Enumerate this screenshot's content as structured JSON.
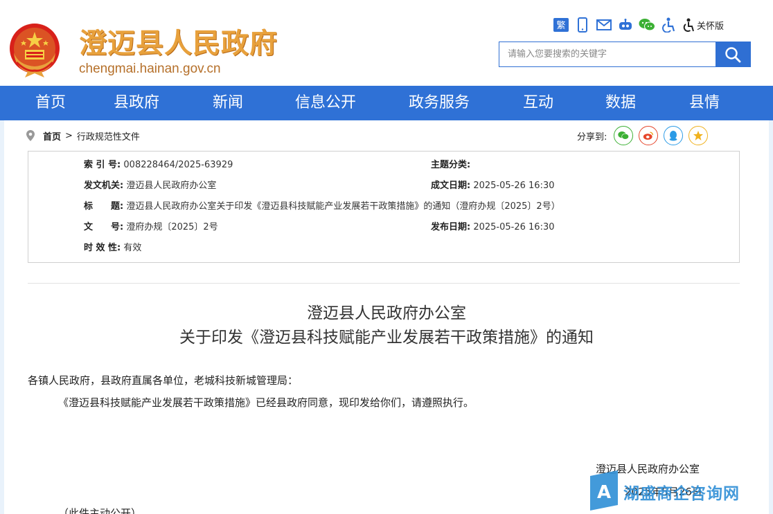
{
  "header": {
    "site_title": "澄迈县人民政府",
    "site_domain": "chengmai.hainan.gov.cn",
    "care_mode_label": "关怀版",
    "search_placeholder": "请输入您要搜索的关键字",
    "icons": [
      "traditional-chinese-icon",
      "mobile-icon",
      "mail-icon",
      "robot-icon",
      "wechat-icon",
      "accessibility-icon",
      "care-mode-icon"
    ],
    "traditional_label": "繁"
  },
  "nav": {
    "items": [
      "首页",
      "县政府",
      "新闻",
      "信息公开",
      "政务服务",
      "互动",
      "数据",
      "县情"
    ]
  },
  "breadcrumb": {
    "home": "首页",
    "separator": ">",
    "current": "行政规范性文件"
  },
  "share": {
    "label": "分享到:",
    "targets": [
      "wechat",
      "weibo",
      "qq",
      "qzone"
    ]
  },
  "meta": {
    "index_key": "索 引 号:",
    "index_val": "008228464/2025-63929",
    "topic_key": "主题分类:",
    "topic_val": "",
    "issuer_key": "发文机关:",
    "issuer_val": "澄迈县人民政府办公室",
    "created_key": "成文日期:",
    "created_val": "2025-05-26 16:30",
    "title_key": "标　　题:",
    "title_val": "澄迈县人民政府办公室关于印发《澄迈县科技赋能产业发展若干政策措施》的通知（澄府办规〔2025〕2号）",
    "docno_key": "文　　号:",
    "docno_val": "澄府办规〔2025〕2号",
    "published_key": "发布日期:",
    "published_val": "2025-05-26 16:30",
    "validity_key": "时 效 性:",
    "validity_val": "有效"
  },
  "document": {
    "title_line1": "澄迈县人民政府办公室",
    "title_line2": "关于印发《澄迈县科技赋能产业发展若干政策措施》的通知",
    "salutation": "各镇人民政府，县政府直属各单位，老城科技新城管理局：",
    "paragraph1": "《澄迈县科技赋能产业发展若干政策措施》已经县政府同意，现印发给你们，请遵照执行。",
    "signature": "澄迈县人民政府办公室",
    "date_partial": "2025年5月26日",
    "public_note": "（此件主动公开）"
  },
  "watermark": {
    "text": "湖盛商企咨询网",
    "logo_letter": "A"
  },
  "colors": {
    "brand_blue": "#2f71d6",
    "title_orange": "#e8a13c",
    "wechat_green": "#3cb034",
    "weibo_red": "#e6462b",
    "qq_blue": "#2b9be6",
    "qzone_yellow": "#f0b21f"
  }
}
